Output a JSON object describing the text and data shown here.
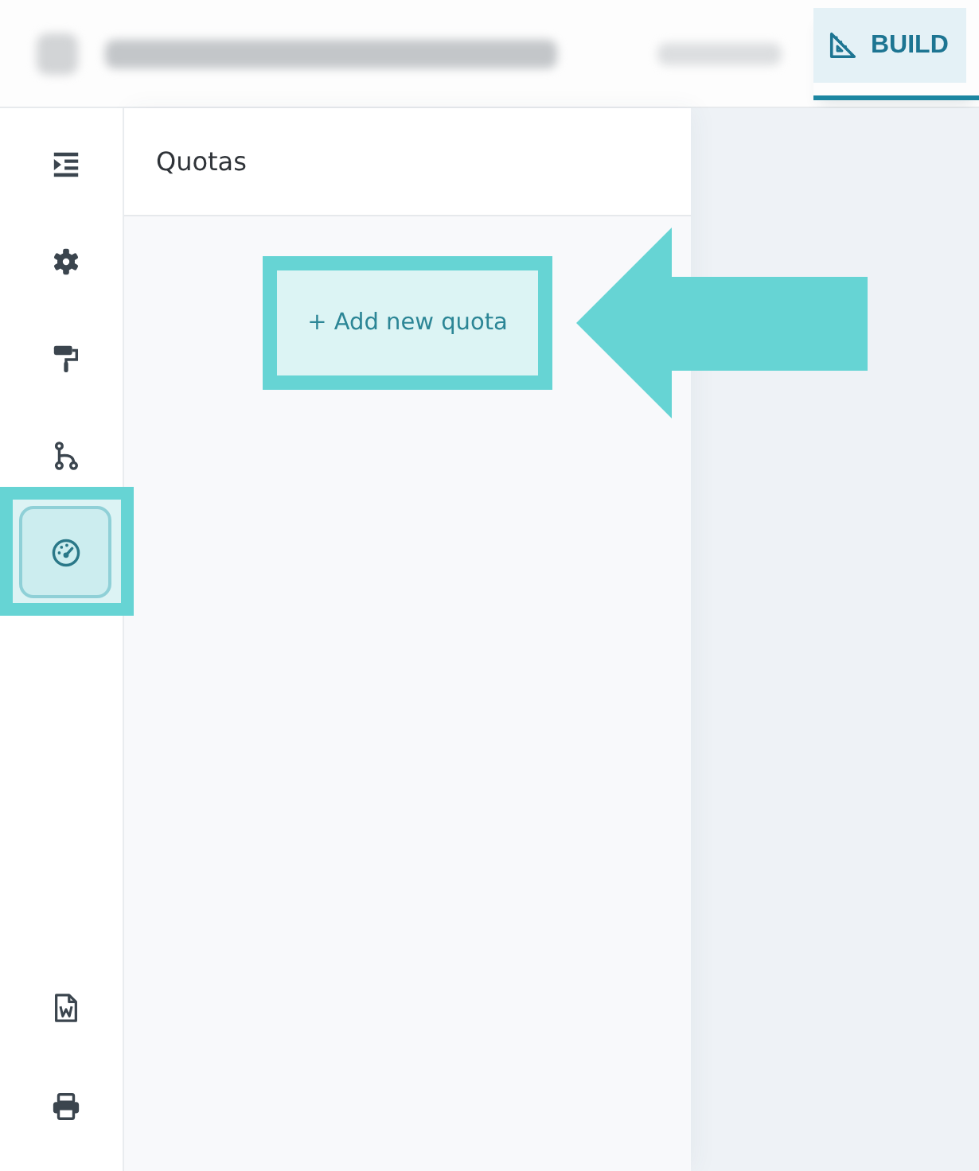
{
  "header": {
    "tabs": [
      {
        "label": "BUILD",
        "selected": true
      }
    ]
  },
  "rail": {
    "items": [
      {
        "selected": false,
        "highlighted": false
      },
      {
        "selected": false,
        "highlighted": false
      },
      {
        "selected": false,
        "highlighted": false
      },
      {
        "selected": false,
        "highlighted": false
      },
      {
        "selected": true,
        "highlighted": true
      }
    ]
  },
  "panel": {
    "title": "Quotas",
    "add_button": {
      "label": "+ Add new quota",
      "highlighted": true,
      "callout_arrow": true
    }
  }
}
